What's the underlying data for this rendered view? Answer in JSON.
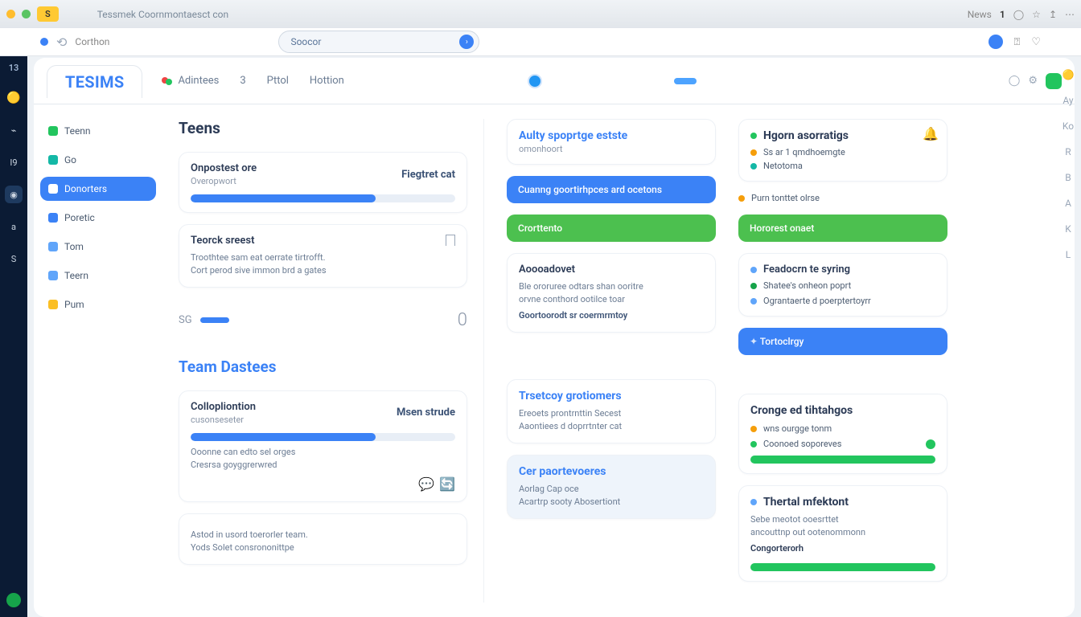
{
  "browser": {
    "tab_label": "S",
    "title": "Tessmek Coornmontaesct con",
    "right": {
      "news": "News",
      "count": "1"
    }
  },
  "url": {
    "site": "Corthon",
    "search_placeholder": "Soocor"
  },
  "app": {
    "title": "TESIMS",
    "nav": {
      "activities": "Adintees",
      "a2": "3",
      "a3": "Pttol",
      "a4": "Hottion"
    }
  },
  "sidebar": {
    "items": [
      {
        "label": "Teenn"
      },
      {
        "label": "Go"
      },
      {
        "label": "Donorters"
      },
      {
        "label": "Poretic"
      },
      {
        "label": "Tom"
      },
      {
        "label": "Teern"
      },
      {
        "label": "Pum"
      }
    ]
  },
  "col1": {
    "h1": "Teens",
    "card1": {
      "title": "Onpostest ore",
      "sub": "Overopwort",
      "right_label": "Fiegtret cat"
    },
    "card2": {
      "title": "Teorck sreest",
      "line1": "Troothtee sam eat oerrate tirtrofft.",
      "line2": "Cort perod sive immon brd a gates"
    },
    "stat": {
      "label": "SG",
      "value": "0"
    },
    "h2": "Team Dastees",
    "card3": {
      "title": "Collopliontion",
      "sub": "cusonseseter",
      "right_label": "Msen strude",
      "line1": "Ooonne can edto sel orges",
      "line2": "Cresrsa goyggrerwred"
    },
    "card4": {
      "line1": "Astod in usord toerorler team.",
      "line2": "Yods Solet consrononittpe"
    }
  },
  "col2": {
    "card1": {
      "title": "Aulty spoprtge estste",
      "sub": "omonhoort"
    },
    "btn_blue": "Cuanng goortirhpces ard ocetons",
    "btn_green": "Crorttento",
    "card2": {
      "title": "Aoooadovet",
      "line1": "Ble ororuree odtars shan ooritre",
      "line2": "orvne conthord ootilce toar",
      "line3": "Goortoorodt sr coermrmtoy"
    },
    "card3": {
      "title": "Trsetcoy grotiomers",
      "line1": "Ereoets prontrnttin Secest",
      "line2": "Aaontiees d doprrtnter cat"
    },
    "card4": {
      "title": "Cer paortevoeres",
      "line1": "Aorlag Cap oce",
      "line2": "Acartrp sooty Abosertiont"
    }
  },
  "col3": {
    "card1": {
      "title": "Hgorn asorratigs",
      "line1": "Ss ar 1 qmdhoemgte",
      "line2": "Netotoma"
    },
    "chip1": "Purn tonttet olrse",
    "btn_green": "Hororest onaet",
    "card2": {
      "l1": "Feadocrn te syring",
      "l2": "Shatee's onheon poprt",
      "l3": "Ograntaerte d poerptertoyrr"
    },
    "btn_blue": "Tortoclrgy",
    "card3": {
      "title": "Cronge ed tihtahgos",
      "l1": "wns ourgge tonm",
      "l2": "Coonoed soporeves"
    },
    "card4": {
      "title": "Thertal mfektont",
      "l1": "Sebe meotot ooesrttet",
      "l2": "ancouttnp out ootenommonn",
      "l3": "Congorterorh"
    }
  }
}
